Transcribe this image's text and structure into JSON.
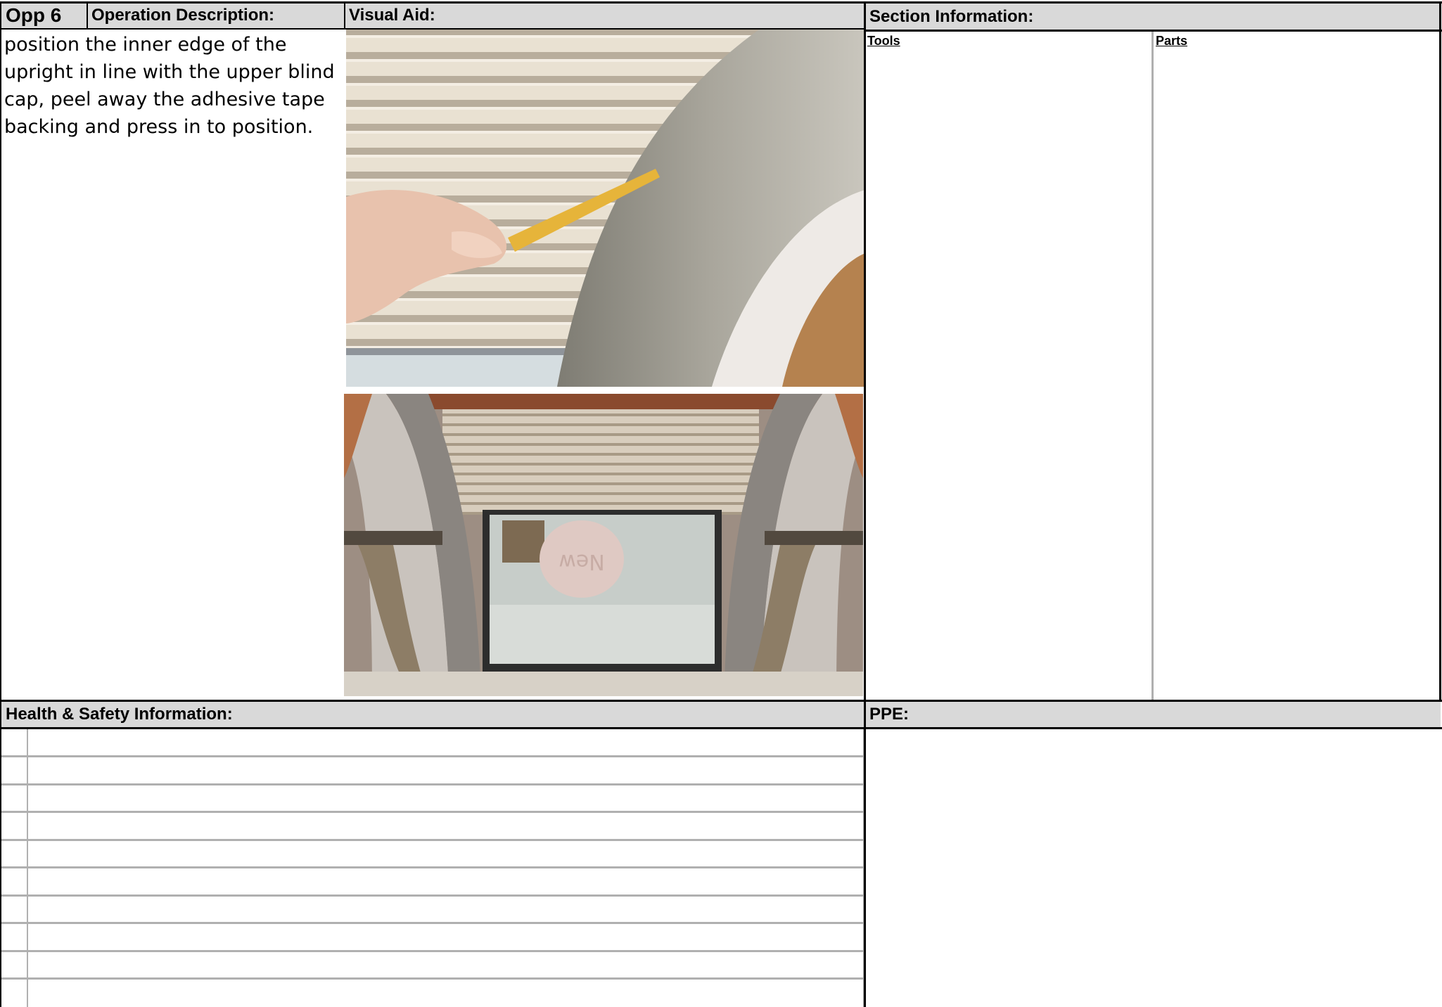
{
  "header": {
    "opp": "Opp 6",
    "operation_description_label": "Operation Description:",
    "visual_aid_label": "Visual Aid:",
    "section_information_label": "Section Information:"
  },
  "operation_description": "position the inner edge of the upright in line with the upper blind cap, peel away the adhesive tape backing and press in to position.",
  "section_information": {
    "tools_label": "Tools",
    "parts_label": "Parts"
  },
  "health_safety_label": "Health & Safety Information:",
  "ppe_label": "PPE:",
  "photo_sign_text": "New",
  "colors": {
    "header_fill": "#d9d9d9",
    "grid_line": "#b0b0b0",
    "border": "#000000"
  }
}
